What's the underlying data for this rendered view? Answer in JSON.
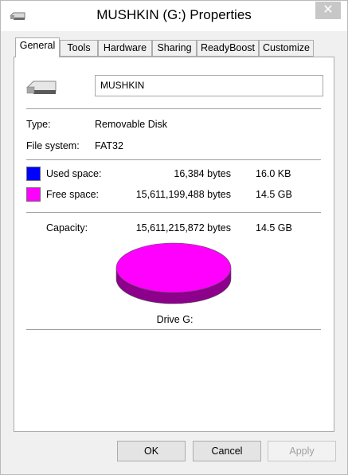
{
  "window": {
    "title": "MUSHKIN (G:) Properties",
    "close_label": "✕"
  },
  "tabs": [
    {
      "label": "General",
      "active": true
    },
    {
      "label": "Tools"
    },
    {
      "label": "Hardware"
    },
    {
      "label": "Sharing"
    },
    {
      "label": "ReadyBoost"
    },
    {
      "label": "Customize"
    }
  ],
  "drive": {
    "name_value": "MUSHKIN",
    "icon": "usb-drive-icon"
  },
  "info": {
    "type_label": "Type:",
    "type_value": "Removable Disk",
    "fs_label": "File system:",
    "fs_value": "FAT32"
  },
  "usage": {
    "used_label": "Used space:",
    "used_bytes": "16,384 bytes",
    "used_size": "16.0 KB",
    "used_color": "#0000ff",
    "free_label": "Free space:",
    "free_bytes": "15,611,199,488 bytes",
    "free_size": "14.5 GB",
    "free_color": "#ff00ff",
    "capacity_label": "Capacity:",
    "capacity_bytes": "15,611,215,872 bytes",
    "capacity_size": "14.5 GB"
  },
  "chart_data": {
    "type": "pie",
    "categories": [
      "Used space",
      "Free space"
    ],
    "values": [
      16384,
      15611199488
    ],
    "colors": [
      "#0000ff",
      "#ff00ff"
    ]
  },
  "drive_label": "Drive G:",
  "buttons": {
    "ok": "OK",
    "cancel": "Cancel",
    "apply": "Apply"
  }
}
